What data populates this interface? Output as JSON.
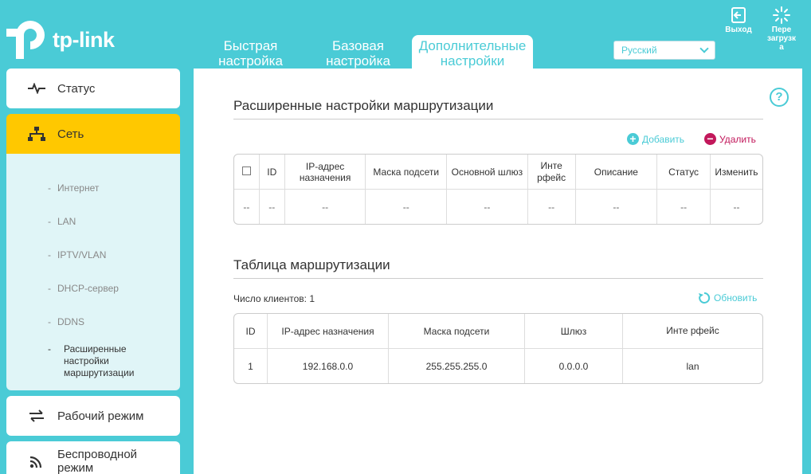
{
  "brand": {
    "logo_text": "tp-link"
  },
  "tabs": [
    {
      "label": "Быстрая настройка"
    },
    {
      "label": "Базовая настройка"
    },
    {
      "label": "Дополнительные настройки"
    }
  ],
  "language": {
    "selected": "Русский"
  },
  "top_buttons": {
    "logout": "Выход",
    "reboot": "Пере загрузк а"
  },
  "sidebar": {
    "items": [
      {
        "label": "Статус",
        "icon": "pulse-icon"
      },
      {
        "label": "Сеть",
        "icon": "network-icon"
      },
      {
        "label": "Рабочий режим",
        "icon": "swap-icon"
      },
      {
        "label": "Беспроводной режим",
        "icon": "wifi-icon"
      }
    ],
    "submenu": [
      "Интернет",
      "LAN",
      "IPTV/VLAN",
      "DHCP-сервер",
      "DDNS",
      "Расширенные настройки маршрутизации"
    ]
  },
  "advanced_routing": {
    "title": "Расширенные настройки маршрутизации",
    "add_label": "Добавить",
    "delete_label": "Удалить",
    "columns": [
      "ID",
      "IP-адрес назначения",
      "Маска подсети",
      "Основной шлюз",
      "Инте рфейс",
      "Описание",
      "Статус",
      "Изменить"
    ],
    "row": [
      "--",
      "--",
      "--",
      "--",
      "--",
      "--",
      "--",
      "--",
      "--"
    ]
  },
  "routing_table": {
    "title": "Таблица маршрутизации",
    "clients_label": "Число клиентов:",
    "clients_count": "1",
    "refresh_label": "Обновить",
    "columns": [
      "ID",
      "IP-адрес назначения",
      "Маска подсети",
      "Шлюз",
      "Инте рфейс"
    ],
    "rows": [
      [
        "1",
        "192.168.0.0",
        "255.255.255.0",
        "0.0.0.0",
        "lan"
      ]
    ]
  },
  "colors": {
    "accent": "#4acbd6",
    "active": "#ffc800",
    "add": "#4acbd6",
    "delete": "#c2185b"
  }
}
